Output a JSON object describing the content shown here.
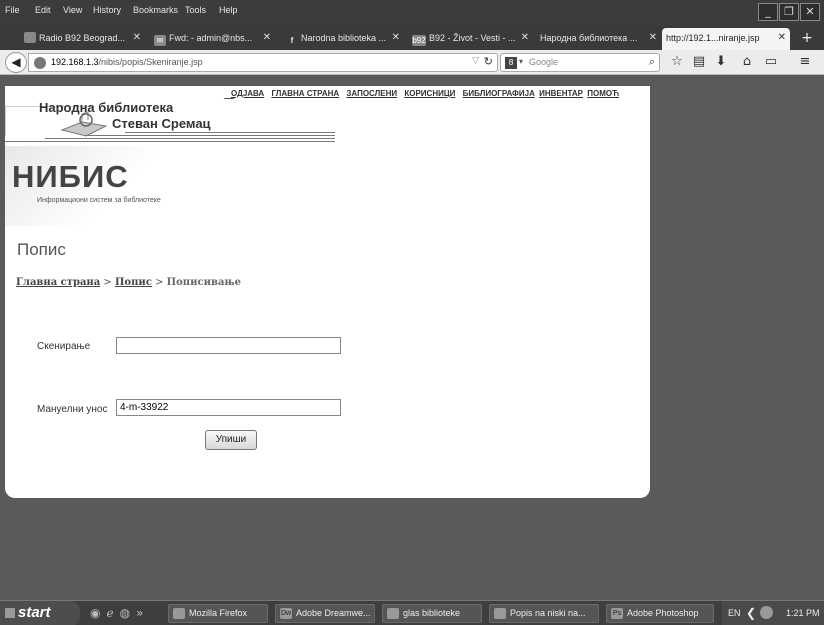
{
  "menubar": {
    "items": [
      "File",
      "Edit",
      "View",
      "History",
      "Bookmarks",
      "Tools",
      "Help"
    ]
  },
  "window_controls": {
    "minimize_glyph": "_",
    "restore_glyph": "❐",
    "close_glyph": "✕"
  },
  "tabs": [
    {
      "title": "Radio B92 Beograd...",
      "icon": "radio-icon"
    },
    {
      "title": "Fwd: - admin@nbs...",
      "icon": "mail-icon"
    },
    {
      "title": "Narodna biblioteka ...",
      "icon": "facebook-icon"
    },
    {
      "title": "B92 - Život - Vesti - ...",
      "icon": "b92-icon"
    },
    {
      "title": "Народна библиотека ...",
      "icon": "page-icon"
    },
    {
      "title": "http://192.1...niranje.jsp",
      "icon": "page-icon",
      "active": true
    }
  ],
  "navbar": {
    "url_host": "192.168.1.3",
    "url_path": "/nibis/popis/Skeniranje.jsp",
    "search_placeholder": "Google",
    "search_engine": "8"
  },
  "site": {
    "library_name_line1": "Народна библиотека",
    "library_name_line2": "Стеван Сремац",
    "system_name": "НИБИС",
    "system_subtitle": "Информациони систем за библиотеке",
    "nav": [
      "ОДЈАВА",
      "ГЛАВНА СТРАНА",
      "ЗАПОСЛЕНИ",
      "КОРИСНИЦИ",
      "БИБЛИОГРАФИЈА",
      "ИНВЕНТАР",
      "ПОМОЋ"
    ]
  },
  "page": {
    "title": "Попис",
    "breadcrumb": {
      "home": "Главна страна",
      "sep1": " > ",
      "section": "Попис",
      "sep2": " > ",
      "current": "Пописивање"
    },
    "scan_label": "Скенирање",
    "scan_value": "",
    "manual_label": "Мануелни унос",
    "manual_value": "4-m-33922",
    "submit_label": "Упиши"
  },
  "taskbar": {
    "start_label": "start",
    "tasks": [
      {
        "label": "Mozilla Firefox",
        "icon": "firefox-icon"
      },
      {
        "label": "Adobe Dreamwe...",
        "icon": "dreamweaver-icon"
      },
      {
        "label": "glas biblioteke",
        "icon": "folder-icon"
      },
      {
        "label": "Popis na niski na...",
        "icon": "document-icon"
      },
      {
        "label": "Adobe Photoshop",
        "icon": "photoshop-icon"
      }
    ],
    "language": "EN",
    "clock": "1:21 PM"
  }
}
